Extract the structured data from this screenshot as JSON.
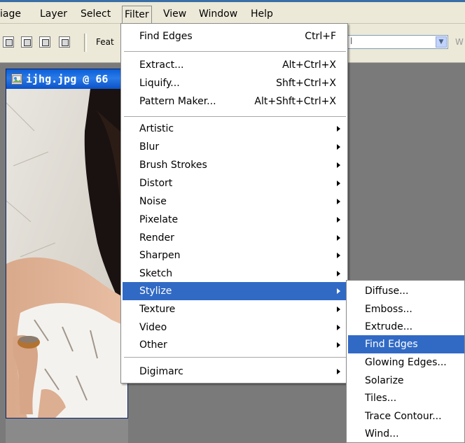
{
  "menubar": {
    "items": [
      {
        "label": "iage"
      },
      {
        "label": "Layer"
      },
      {
        "label": "Select"
      },
      {
        "label": "Filter"
      },
      {
        "label": "View"
      },
      {
        "label": "Window"
      },
      {
        "label": "Help"
      }
    ]
  },
  "options_bar": {
    "feather_label": "Feat",
    "combo_value": "l",
    "trailing_label": "W"
  },
  "document": {
    "title": "ijhg.jpg @ 66"
  },
  "filter_menu": {
    "items": [
      {
        "label": "Find Edges",
        "shortcut": "Ctrl+F"
      },
      {
        "label": "Extract...",
        "shortcut": "Alt+Ctrl+X"
      },
      {
        "label": "Liquify...",
        "shortcut": "Shft+Ctrl+X"
      },
      {
        "label": "Pattern Maker...",
        "shortcut": "Alt+Shft+Ctrl+X"
      },
      {
        "label": "Artistic"
      },
      {
        "label": "Blur"
      },
      {
        "label": "Brush Strokes"
      },
      {
        "label": "Distort"
      },
      {
        "label": "Noise"
      },
      {
        "label": "Pixelate"
      },
      {
        "label": "Render"
      },
      {
        "label": "Sharpen"
      },
      {
        "label": "Sketch"
      },
      {
        "label": "Stylize",
        "highlighted": true
      },
      {
        "label": "Texture"
      },
      {
        "label": "Video"
      },
      {
        "label": "Other"
      },
      {
        "label": "Digimarc"
      }
    ]
  },
  "stylize_submenu": {
    "items": [
      {
        "label": "Diffuse..."
      },
      {
        "label": "Emboss..."
      },
      {
        "label": "Extrude..."
      },
      {
        "label": "Find Edges",
        "highlighted": true
      },
      {
        "label": "Glowing Edges..."
      },
      {
        "label": "Solarize"
      },
      {
        "label": "Tiles..."
      },
      {
        "label": "Trace Contour..."
      },
      {
        "label": "Wind..."
      }
    ]
  },
  "colors": {
    "highlight": "#316ac5",
    "menu_background": "#ffffff",
    "chrome": "#ece9d8",
    "workspace": "#7a7a7a",
    "title_bar": "#0a5fd8"
  }
}
